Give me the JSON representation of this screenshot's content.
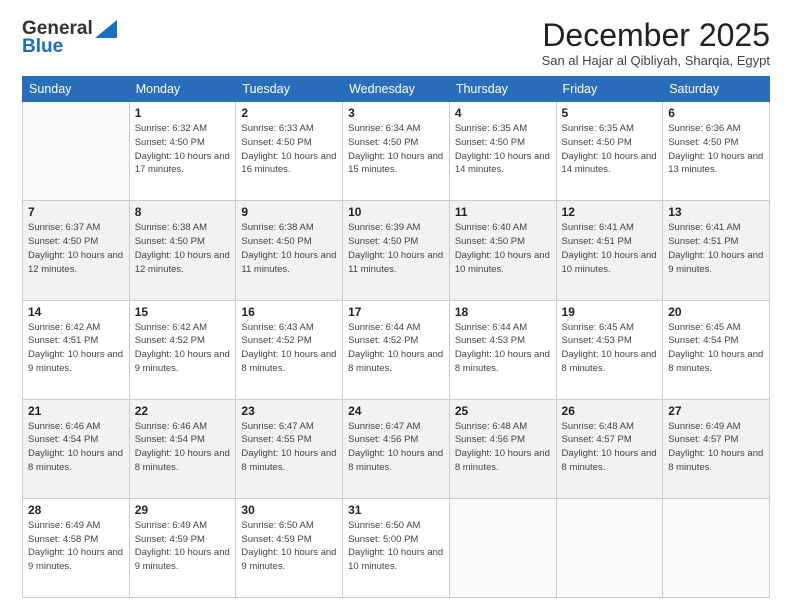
{
  "logo": {
    "line1": "General",
    "line2": "Blue"
  },
  "header": {
    "month": "December 2025",
    "location": "San al Hajar al Qibliyah, Sharqia, Egypt"
  },
  "weekdays": [
    "Sunday",
    "Monday",
    "Tuesday",
    "Wednesday",
    "Thursday",
    "Friday",
    "Saturday"
  ],
  "weeks": [
    [
      {
        "day": "",
        "sunrise": "",
        "sunset": "",
        "daylight": ""
      },
      {
        "day": "1",
        "sunrise": "Sunrise: 6:32 AM",
        "sunset": "Sunset: 4:50 PM",
        "daylight": "Daylight: 10 hours and 17 minutes."
      },
      {
        "day": "2",
        "sunrise": "Sunrise: 6:33 AM",
        "sunset": "Sunset: 4:50 PM",
        "daylight": "Daylight: 10 hours and 16 minutes."
      },
      {
        "day": "3",
        "sunrise": "Sunrise: 6:34 AM",
        "sunset": "Sunset: 4:50 PM",
        "daylight": "Daylight: 10 hours and 15 minutes."
      },
      {
        "day": "4",
        "sunrise": "Sunrise: 6:35 AM",
        "sunset": "Sunset: 4:50 PM",
        "daylight": "Daylight: 10 hours and 14 minutes."
      },
      {
        "day": "5",
        "sunrise": "Sunrise: 6:35 AM",
        "sunset": "Sunset: 4:50 PM",
        "daylight": "Daylight: 10 hours and 14 minutes."
      },
      {
        "day": "6",
        "sunrise": "Sunrise: 6:36 AM",
        "sunset": "Sunset: 4:50 PM",
        "daylight": "Daylight: 10 hours and 13 minutes."
      }
    ],
    [
      {
        "day": "7",
        "sunrise": "Sunrise: 6:37 AM",
        "sunset": "Sunset: 4:50 PM",
        "daylight": "Daylight: 10 hours and 12 minutes."
      },
      {
        "day": "8",
        "sunrise": "Sunrise: 6:38 AM",
        "sunset": "Sunset: 4:50 PM",
        "daylight": "Daylight: 10 hours and 12 minutes."
      },
      {
        "day": "9",
        "sunrise": "Sunrise: 6:38 AM",
        "sunset": "Sunset: 4:50 PM",
        "daylight": "Daylight: 10 hours and 11 minutes."
      },
      {
        "day": "10",
        "sunrise": "Sunrise: 6:39 AM",
        "sunset": "Sunset: 4:50 PM",
        "daylight": "Daylight: 10 hours and 11 minutes."
      },
      {
        "day": "11",
        "sunrise": "Sunrise: 6:40 AM",
        "sunset": "Sunset: 4:50 PM",
        "daylight": "Daylight: 10 hours and 10 minutes."
      },
      {
        "day": "12",
        "sunrise": "Sunrise: 6:41 AM",
        "sunset": "Sunset: 4:51 PM",
        "daylight": "Daylight: 10 hours and 10 minutes."
      },
      {
        "day": "13",
        "sunrise": "Sunrise: 6:41 AM",
        "sunset": "Sunset: 4:51 PM",
        "daylight": "Daylight: 10 hours and 9 minutes."
      }
    ],
    [
      {
        "day": "14",
        "sunrise": "Sunrise: 6:42 AM",
        "sunset": "Sunset: 4:51 PM",
        "daylight": "Daylight: 10 hours and 9 minutes."
      },
      {
        "day": "15",
        "sunrise": "Sunrise: 6:42 AM",
        "sunset": "Sunset: 4:52 PM",
        "daylight": "Daylight: 10 hours and 9 minutes."
      },
      {
        "day": "16",
        "sunrise": "Sunrise: 6:43 AM",
        "sunset": "Sunset: 4:52 PM",
        "daylight": "Daylight: 10 hours and 8 minutes."
      },
      {
        "day": "17",
        "sunrise": "Sunrise: 6:44 AM",
        "sunset": "Sunset: 4:52 PM",
        "daylight": "Daylight: 10 hours and 8 minutes."
      },
      {
        "day": "18",
        "sunrise": "Sunrise: 6:44 AM",
        "sunset": "Sunset: 4:53 PM",
        "daylight": "Daylight: 10 hours and 8 minutes."
      },
      {
        "day": "19",
        "sunrise": "Sunrise: 6:45 AM",
        "sunset": "Sunset: 4:53 PM",
        "daylight": "Daylight: 10 hours and 8 minutes."
      },
      {
        "day": "20",
        "sunrise": "Sunrise: 6:45 AM",
        "sunset": "Sunset: 4:54 PM",
        "daylight": "Daylight: 10 hours and 8 minutes."
      }
    ],
    [
      {
        "day": "21",
        "sunrise": "Sunrise: 6:46 AM",
        "sunset": "Sunset: 4:54 PM",
        "daylight": "Daylight: 10 hours and 8 minutes."
      },
      {
        "day": "22",
        "sunrise": "Sunrise: 6:46 AM",
        "sunset": "Sunset: 4:54 PM",
        "daylight": "Daylight: 10 hours and 8 minutes."
      },
      {
        "day": "23",
        "sunrise": "Sunrise: 6:47 AM",
        "sunset": "Sunset: 4:55 PM",
        "daylight": "Daylight: 10 hours and 8 minutes."
      },
      {
        "day": "24",
        "sunrise": "Sunrise: 6:47 AM",
        "sunset": "Sunset: 4:56 PM",
        "daylight": "Daylight: 10 hours and 8 minutes."
      },
      {
        "day": "25",
        "sunrise": "Sunrise: 6:48 AM",
        "sunset": "Sunset: 4:56 PM",
        "daylight": "Daylight: 10 hours and 8 minutes."
      },
      {
        "day": "26",
        "sunrise": "Sunrise: 6:48 AM",
        "sunset": "Sunset: 4:57 PM",
        "daylight": "Daylight: 10 hours and 8 minutes."
      },
      {
        "day": "27",
        "sunrise": "Sunrise: 6:49 AM",
        "sunset": "Sunset: 4:57 PM",
        "daylight": "Daylight: 10 hours and 8 minutes."
      }
    ],
    [
      {
        "day": "28",
        "sunrise": "Sunrise: 6:49 AM",
        "sunset": "Sunset: 4:58 PM",
        "daylight": "Daylight: 10 hours and 9 minutes."
      },
      {
        "day": "29",
        "sunrise": "Sunrise: 6:49 AM",
        "sunset": "Sunset: 4:59 PM",
        "daylight": "Daylight: 10 hours and 9 minutes."
      },
      {
        "day": "30",
        "sunrise": "Sunrise: 6:50 AM",
        "sunset": "Sunset: 4:59 PM",
        "daylight": "Daylight: 10 hours and 9 minutes."
      },
      {
        "day": "31",
        "sunrise": "Sunrise: 6:50 AM",
        "sunset": "Sunset: 5:00 PM",
        "daylight": "Daylight: 10 hours and 10 minutes."
      },
      {
        "day": "",
        "sunrise": "",
        "sunset": "",
        "daylight": ""
      },
      {
        "day": "",
        "sunrise": "",
        "sunset": "",
        "daylight": ""
      },
      {
        "day": "",
        "sunrise": "",
        "sunset": "",
        "daylight": ""
      }
    ]
  ]
}
